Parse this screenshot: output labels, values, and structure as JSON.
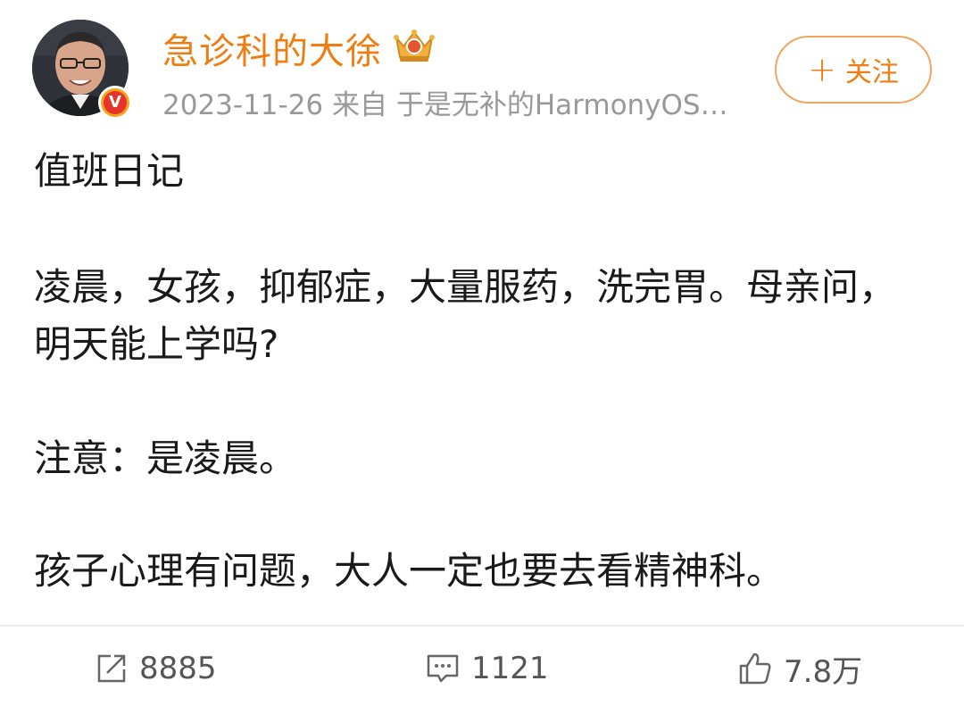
{
  "post": {
    "author": {
      "name": "急诊科的大徐",
      "verified_badge": "V",
      "avatar_icon": "avatar-photo",
      "badge_icon": "crown-badge-icon"
    },
    "meta": "2023-11-26 来自 于是无补的HarmonyOS…",
    "follow": {
      "plus": "+",
      "label": "关注"
    },
    "content": {
      "p1": "值班日记",
      "p2": "凌晨，女孩，抑郁症，大量服药，洗完胃。母亲问，明天能上学吗?",
      "p3": "注意：是凌晨。",
      "p4": "孩子心理有问题，大人一定也要去看精神科。"
    },
    "actions": {
      "repost": {
        "icon": "repost-icon",
        "count": "8885"
      },
      "comment": {
        "icon": "comment-icon",
        "count": "1121"
      },
      "like": {
        "icon": "like-icon",
        "count": "7.8万"
      }
    },
    "colors": {
      "accent": "#f07d11",
      "follow_border": "#f2a35f",
      "meta_text": "#999999",
      "body_text": "#1a1a1a",
      "verified_outer": "#f4a51c",
      "verified_inner": "#e8332a"
    }
  }
}
